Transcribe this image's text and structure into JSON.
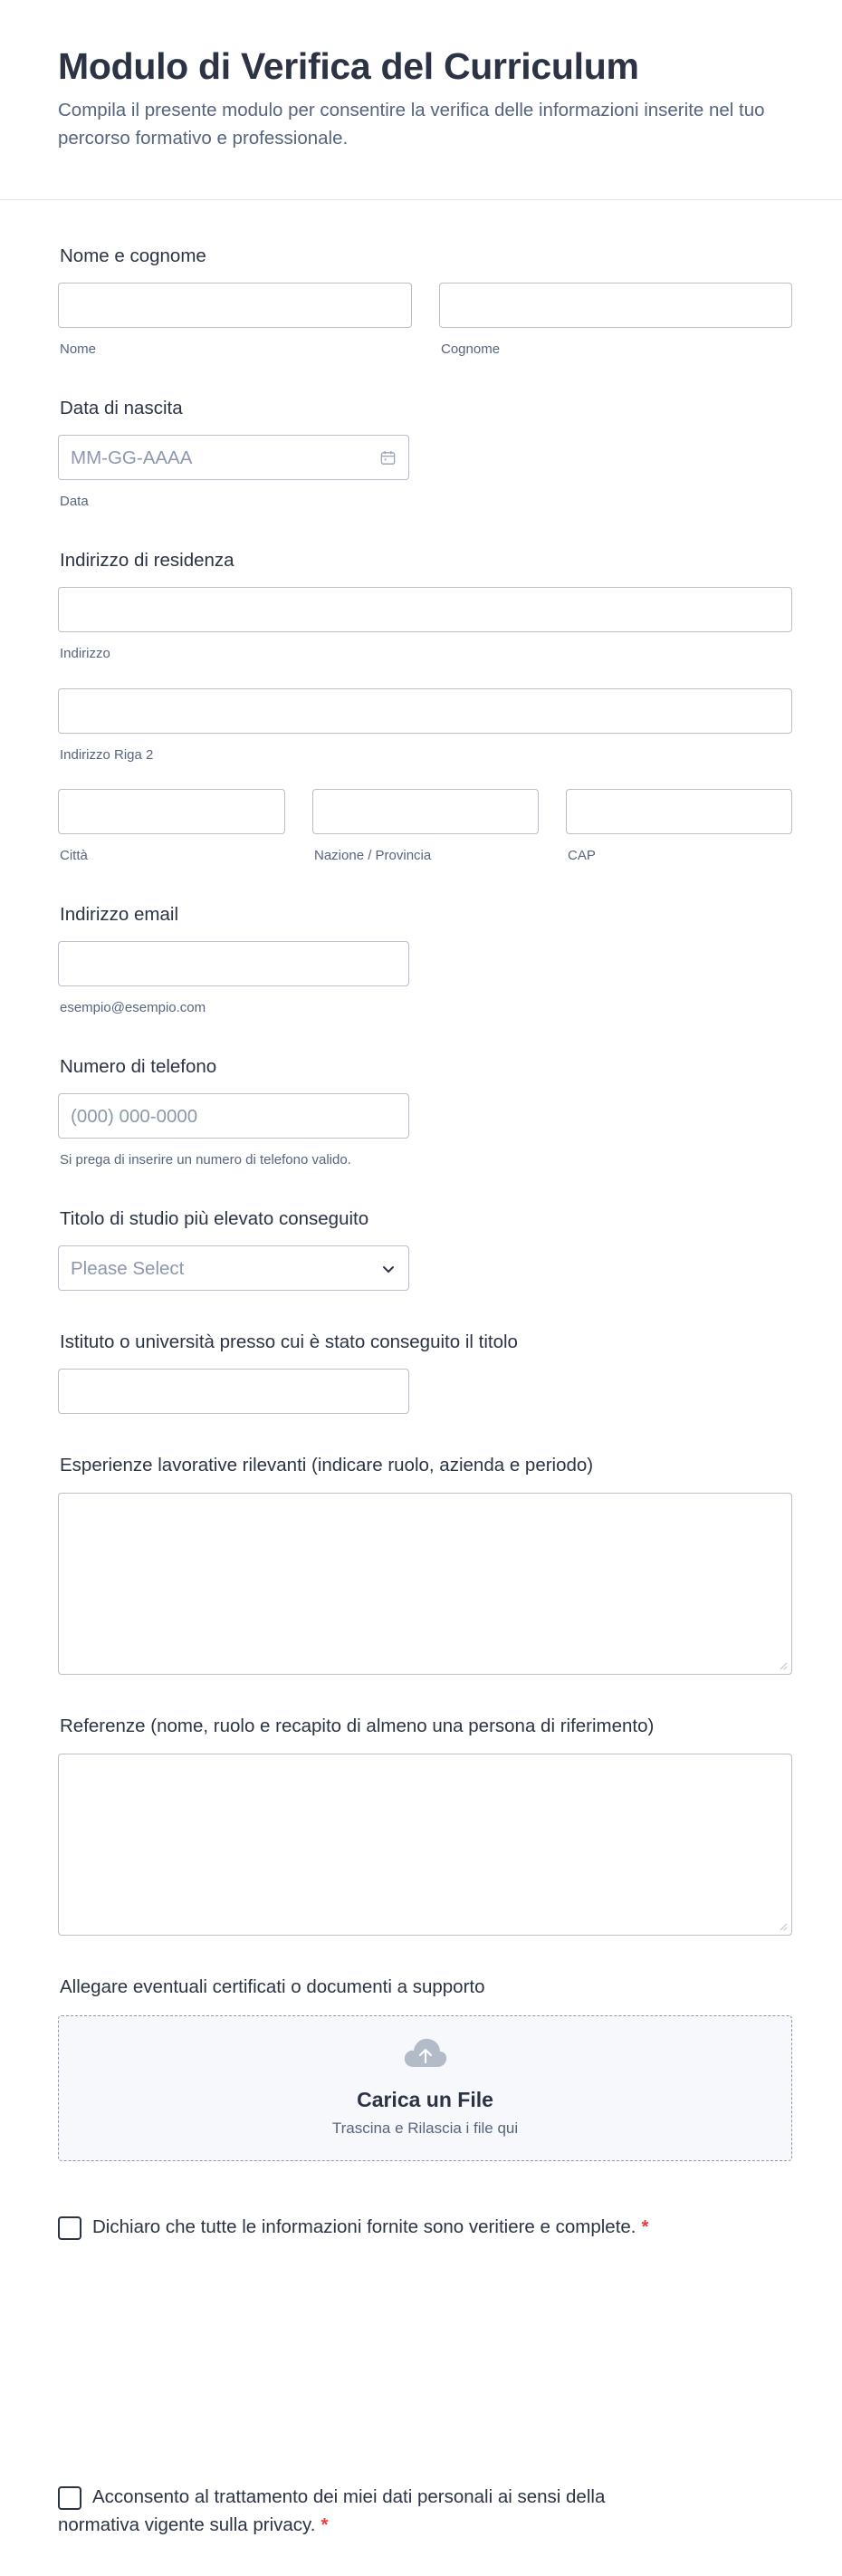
{
  "header": {
    "title": "Modulo di Verifica del Curriculum",
    "subtitle": "Compila il presente modulo per consentire la verifica delle informazioni inserite nel tuo percorso formativo e professionale."
  },
  "name_section": {
    "label": "Nome e cognome",
    "first_sub": "Nome",
    "last_sub": "Cognome",
    "first_value": "",
    "last_value": ""
  },
  "birth_section": {
    "label": "Data di nascita",
    "placeholder": "MM-GG-AAAA",
    "sub": "Data"
  },
  "address_section": {
    "label": "Indirizzo di residenza",
    "line1_sub": "Indirizzo",
    "line2_sub": "Indirizzo Riga 2",
    "city_sub": "Città",
    "state_sub": "Nazione / Provincia",
    "zip_sub": "CAP"
  },
  "email_section": {
    "label": "Indirizzo email",
    "sub": "esempio@esempio.com"
  },
  "phone_section": {
    "label": "Numero di telefono",
    "placeholder": "(000) 000-0000",
    "sub": "Si prega di inserire un numero di telefono valido."
  },
  "degree_section": {
    "label": "Titolo di studio più elevato conseguito",
    "selected": "Please Select"
  },
  "institute_section": {
    "label": "Istituto o università presso cui è stato conseguito il titolo"
  },
  "experience_section": {
    "label": "Esperienze lavorative rilevanti (indicare ruolo, azienda e periodo)"
  },
  "references_section": {
    "label": "Referenze (nome, ruolo e recapito di almeno una persona di riferimento)"
  },
  "upload_section": {
    "label": "Allegare eventuali certificati o documenti a supporto",
    "title": "Carica un File",
    "subtitle": "Trascina e Rilascia i file qui"
  },
  "declaration": {
    "text": "Dichiaro che tutte le informazioni fornite sono veritiere e complete.",
    "required_mark": "*",
    "checked": false
  },
  "consent": {
    "text": "Acconsento al trattamento dei miei dati personali ai sensi della normativa vigente sulla privacy.",
    "required_mark": "*",
    "checked": false
  },
  "icons": {
    "date": "calendar-icon",
    "select": "chevron-down-icon",
    "upload": "cloud-upload-icon"
  },
  "colors": {
    "text": "#2c3345",
    "muted": "#57647e",
    "border": "#b8bdc9",
    "required": "#f23a3c",
    "upload_bg": "#f7f8fc"
  }
}
